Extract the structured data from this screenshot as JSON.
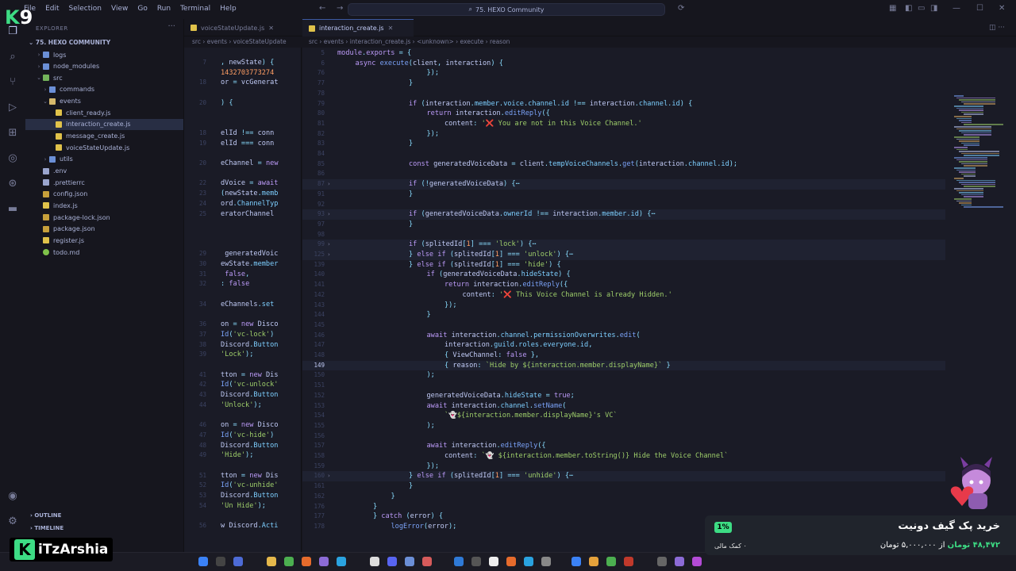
{
  "title_bar": {
    "menus": [
      "File",
      "Edit",
      "Selection",
      "View",
      "Go",
      "Run",
      "Terminal",
      "Help"
    ],
    "search_text": "75. HEXO Community"
  },
  "sidebar": {
    "title": "EXPLORER",
    "project": "75. HEXO COMMUNITY",
    "items": [
      {
        "label": "logs",
        "depth": 1,
        "kind": "folder",
        "twist": "›"
      },
      {
        "label": "node_modules",
        "depth": 1,
        "kind": "folder",
        "twist": "›"
      },
      {
        "label": "src",
        "depth": 1,
        "kind": "folder-green",
        "twist": "⌄"
      },
      {
        "label": "commands",
        "depth": 2,
        "kind": "folder",
        "twist": "›"
      },
      {
        "label": "events",
        "depth": 2,
        "kind": "folder-yel",
        "twist": "⌄"
      },
      {
        "label": "client_ready.js",
        "depth": 3,
        "kind": "js",
        "twist": ""
      },
      {
        "label": "interaction_create.js",
        "depth": 3,
        "kind": "js",
        "twist": "",
        "selected": true
      },
      {
        "label": "message_create.js",
        "depth": 3,
        "kind": "js",
        "twist": ""
      },
      {
        "label": "voiceStateUpdate.js",
        "depth": 3,
        "kind": "js",
        "twist": ""
      },
      {
        "label": "utils",
        "depth": 2,
        "kind": "folder",
        "twist": "›"
      },
      {
        "label": ".env",
        "depth": 1,
        "kind": "dot",
        "twist": ""
      },
      {
        "label": ".prettierrc",
        "depth": 1,
        "kind": "dot",
        "twist": ""
      },
      {
        "label": "config.json",
        "depth": 1,
        "kind": "json",
        "twist": ""
      },
      {
        "label": "index.js",
        "depth": 1,
        "kind": "js",
        "twist": ""
      },
      {
        "label": "package-lock.json",
        "depth": 1,
        "kind": "json",
        "twist": ""
      },
      {
        "label": "package.json",
        "depth": 1,
        "kind": "json",
        "twist": ""
      },
      {
        "label": "register.js",
        "depth": 1,
        "kind": "js",
        "twist": ""
      },
      {
        "label": "todo.md",
        "depth": 1,
        "kind": "md",
        "twist": ""
      }
    ],
    "outline": "OUTLINE",
    "timeline": "TIMELINE"
  },
  "tabs": [
    {
      "label": "voiceStateUpdate.js",
      "active": false
    },
    {
      "label": "interaction_create.js",
      "active": true
    }
  ],
  "left_breadcrumb": [
    "src",
    "events",
    "voiceStateUpdate"
  ],
  "right_breadcrumb": [
    "src",
    "events",
    "interaction_create.js",
    "<unknown>",
    "execute",
    "reason"
  ],
  "left_editor": {
    "lines": [
      {
        "n": "7",
        "t": ", newState) {"
      },
      {
        "n": "",
        "t": "1432703773274"
      },
      {
        "n": "18",
        "t": "or = vcGenerat"
      },
      {
        "n": "",
        "t": ""
      },
      {
        "n": "20",
        "t": ") {"
      },
      {
        "n": "",
        "t": ""
      },
      {
        "n": "",
        "t": ""
      },
      {
        "n": "18",
        "t": "elId !== conn"
      },
      {
        "n": "19",
        "t": "elId === conn"
      },
      {
        "n": "",
        "t": ""
      },
      {
        "n": "20",
        "t": "eChannel = new"
      },
      {
        "n": "",
        "t": ""
      },
      {
        "n": "22",
        "t": "dVoice = await"
      },
      {
        "n": "23",
        "t": "(newState.memb"
      },
      {
        "n": "24",
        "t": "ord.ChannelTyp"
      },
      {
        "n": "25",
        "t": "eratorChannel"
      },
      {
        "n": "",
        "t": ""
      },
      {
        "n": "",
        "t": ""
      },
      {
        "n": "",
        "t": ""
      },
      {
        "n": "29",
        "t": " generatedVoic"
      },
      {
        "n": "30",
        "t": "ewState.member"
      },
      {
        "n": "31",
        "t": " false,"
      },
      {
        "n": "32",
        "t": ": false"
      },
      {
        "n": "",
        "t": ""
      },
      {
        "n": "34",
        "t": "eChannels.set"
      },
      {
        "n": "",
        "t": ""
      },
      {
        "n": "36",
        "t": "on = new Disco"
      },
      {
        "n": "37",
        "t": "Id('vc-lock')"
      },
      {
        "n": "38",
        "t": "Discord.Button"
      },
      {
        "n": "39",
        "t": "'Lock');"
      },
      {
        "n": "",
        "t": ""
      },
      {
        "n": "41",
        "t": "tton = new Dis"
      },
      {
        "n": "42",
        "t": "Id('vc-unlock'"
      },
      {
        "n": "43",
        "t": "Discord.Button"
      },
      {
        "n": "44",
        "t": "'Unlock');"
      },
      {
        "n": "",
        "t": ""
      },
      {
        "n": "46",
        "t": "on = new Disco"
      },
      {
        "n": "47",
        "t": "Id('vc-hide')"
      },
      {
        "n": "48",
        "t": "Discord.Button"
      },
      {
        "n": "49",
        "t": "'Hide');"
      },
      {
        "n": "",
        "t": ""
      },
      {
        "n": "51",
        "t": "tton = new Dis"
      },
      {
        "n": "52",
        "t": "Id('vc-unhide'"
      },
      {
        "n": "53",
        "t": "Discord.Button"
      },
      {
        "n": "54",
        "t": "'Un Hide');"
      },
      {
        "n": "",
        "t": ""
      },
      {
        "n": "56",
        "t": "w Discord.Acti"
      }
    ]
  },
  "right_editor": {
    "lines": [
      {
        "n": "5",
        "indent": 0,
        "t": "module.exports = {"
      },
      {
        "n": "6",
        "indent": 1,
        "t": "async execute(client, interaction) {"
      },
      {
        "n": "76",
        "indent": 5,
        "t": "});"
      },
      {
        "n": "77",
        "indent": 4,
        "t": "}"
      },
      {
        "n": "78",
        "indent": 0,
        "t": ""
      },
      {
        "n": "79",
        "indent": 4,
        "t": "if (interaction.member.voice.channel.id !== interaction.channel.id) {"
      },
      {
        "n": "80",
        "indent": 5,
        "t": "return interaction.editReply({"
      },
      {
        "n": "81",
        "indent": 6,
        "t": "content: '❌ You are not in this Voice Channel.'"
      },
      {
        "n": "82",
        "indent": 5,
        "t": "});"
      },
      {
        "n": "83",
        "indent": 4,
        "t": "}"
      },
      {
        "n": "84",
        "indent": 0,
        "t": ""
      },
      {
        "n": "85",
        "indent": 4,
        "t": "const generatedVoiceData = client.tempVoiceChannels.get(interaction.channel.id);"
      },
      {
        "n": "86",
        "indent": 0,
        "t": ""
      },
      {
        "n": "87",
        "indent": 4,
        "t": "if (!generatedVoiceData) {⋯",
        "fold": true
      },
      {
        "n": "91",
        "indent": 4,
        "t": "}"
      },
      {
        "n": "92",
        "indent": 0,
        "t": ""
      },
      {
        "n": "93",
        "indent": 4,
        "t": "if (generatedVoiceData.ownerId !== interaction.member.id) {⋯",
        "fold": true
      },
      {
        "n": "97",
        "indent": 4,
        "t": "}"
      },
      {
        "n": "98",
        "indent": 0,
        "t": ""
      },
      {
        "n": "99",
        "indent": 4,
        "t": "if (splitedId[1] === 'lock') {⋯",
        "fold": true
      },
      {
        "n": "125",
        "indent": 4,
        "t": "} else if (splitedId[1] === 'unlock') {⋯",
        "fold": true
      },
      {
        "n": "139",
        "indent": 4,
        "t": "} else if (splitedId[1] === 'hide') {"
      },
      {
        "n": "140",
        "indent": 5,
        "t": "if (generatedVoiceData.hideState) {"
      },
      {
        "n": "141",
        "indent": 6,
        "t": "return interaction.editReply({"
      },
      {
        "n": "142",
        "indent": 7,
        "t": "content: '❌ This Voice Channel is already Hidden.'"
      },
      {
        "n": "143",
        "indent": 6,
        "t": "});"
      },
      {
        "n": "144",
        "indent": 5,
        "t": "}"
      },
      {
        "n": "145",
        "indent": 0,
        "t": ""
      },
      {
        "n": "146",
        "indent": 5,
        "t": "await interaction.channel.permissionOverwrites.edit("
      },
      {
        "n": "147",
        "indent": 6,
        "t": "interaction.guild.roles.everyone.id,"
      },
      {
        "n": "148",
        "indent": 6,
        "t": "{ ViewChannel: false },"
      },
      {
        "n": "149",
        "indent": 6,
        "t": "{ reason: `Hide by ${interaction.member.displayName}` }",
        "current": true
      },
      {
        "n": "150",
        "indent": 5,
        "t": ");"
      },
      {
        "n": "151",
        "indent": 0,
        "t": ""
      },
      {
        "n": "152",
        "indent": 5,
        "t": "generatedVoiceData.hideState = true;"
      },
      {
        "n": "153",
        "indent": 5,
        "t": "await interaction.channel.setName("
      },
      {
        "n": "154",
        "indent": 6,
        "t": "`👻${interaction.member.displayName}'s VC`"
      },
      {
        "n": "155",
        "indent": 5,
        "t": ");"
      },
      {
        "n": "156",
        "indent": 0,
        "t": ""
      },
      {
        "n": "157",
        "indent": 5,
        "t": "await interaction.editReply({"
      },
      {
        "n": "158",
        "indent": 6,
        "t": "content: `👻 ${interaction.member.toString()} Hide the Voice Channel`"
      },
      {
        "n": "159",
        "indent": 5,
        "t": "});"
      },
      {
        "n": "160",
        "indent": 4,
        "t": "} else if (splitedId[1] === 'unhide') {⋯",
        "fold": true
      },
      {
        "n": "161",
        "indent": 4,
        "t": "}"
      },
      {
        "n": "162",
        "indent": 3,
        "t": "}"
      },
      {
        "n": "176",
        "indent": 2,
        "t": "}"
      },
      {
        "n": "177",
        "indent": 2,
        "t": "} catch (error) {"
      },
      {
        "n": "178",
        "indent": 3,
        "t": "logError(error);"
      }
    ]
  },
  "overlay": {
    "logo": "9",
    "brand_letter": "K",
    "brand_text": "iTzArshia",
    "donate_title": "خرید پک گیف دونیت",
    "donate_price_label": "۴۸,۴۷۲ تومان",
    "donate_price_rest": "از ۵,۰۰۰,۰۰۰ تومان",
    "percent": "1%",
    "support": "۰ کمک مالی"
  },
  "colors": {
    "accent": "#3d59a1",
    "brand_green": "#3ddc84",
    "bg": "#1a1b26"
  }
}
